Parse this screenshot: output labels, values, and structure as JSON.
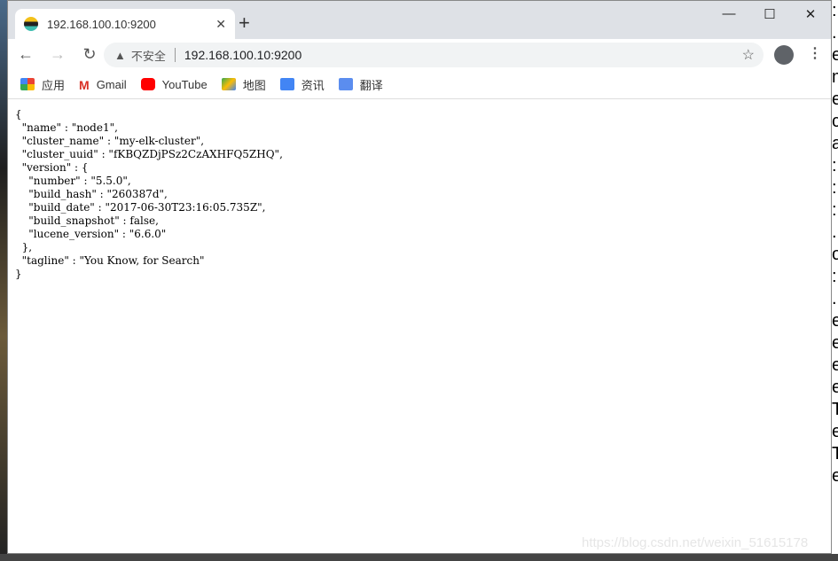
{
  "tab": {
    "title": "192.168.100.10:9200"
  },
  "toolbar": {
    "insecure": "不安全",
    "url": "192.168.100.10:9200"
  },
  "bookmarks": [
    {
      "label": "应用",
      "icon": "apps-icon"
    },
    {
      "label": "Gmail",
      "icon": "gmail-icon"
    },
    {
      "label": "YouTube",
      "icon": "youtube-icon"
    },
    {
      "label": "地图",
      "icon": "maps-icon"
    },
    {
      "label": "资讯",
      "icon": "news-icon"
    },
    {
      "label": "翻译",
      "icon": "translate-icon"
    }
  ],
  "json_text": "{\n  \"name\" : \"node1\",\n  \"cluster_name\" : \"my-elk-cluster\",\n  \"cluster_uuid\" : \"fKBQZDjPSz2CzAXHFQ5ZHQ\",\n  \"version\" : {\n    \"number\" : \"5.5.0\",\n    \"build_hash\" : \"260387d\",\n    \"build_date\" : \"2017-06-30T23:16:05.735Z\",\n    \"build_snapshot\" : false,\n    \"lucene_version\" : \"6.6.0\"\n  },\n  \"tagline\" : \"You Know, for Search\"\n}",
  "watermark": "https://blog.csdn.net/weixin_51615178",
  "background_right_text": ": . e m e c a : : : . o : . e e e e T e T e"
}
